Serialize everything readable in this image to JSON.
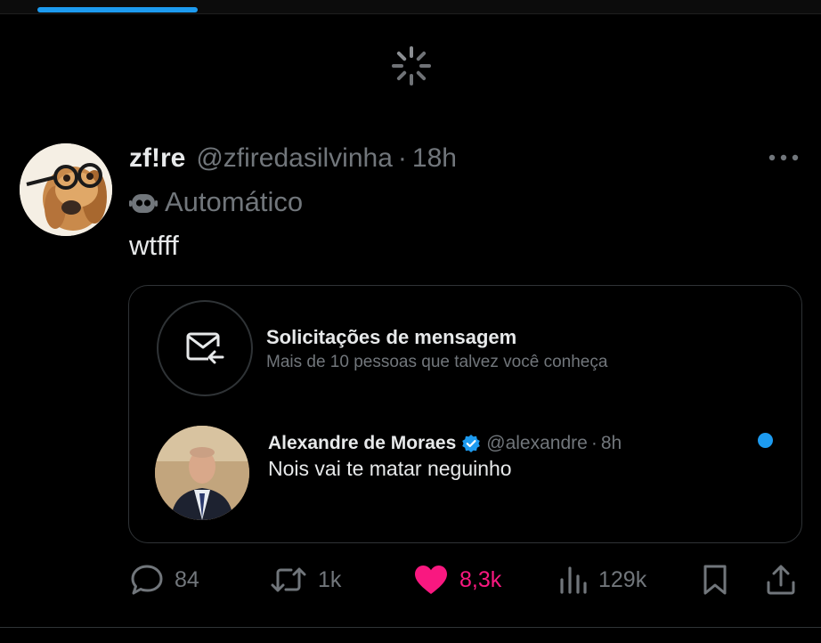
{
  "post": {
    "display_name": "zf!re",
    "handle": "@zfiredasilvinha",
    "separator": "·",
    "time": "18h",
    "automated_label": "Automático",
    "text": "wtfff",
    "avatar_icon": "dog-with-glasses-avatar",
    "more_icon": "more-dots-icon"
  },
  "embedded_card": {
    "requests_title": "Solicitações de mensagem",
    "requests_subtitle": "Mais de 10 pessoas que talvez você conheça",
    "requests_icon": "envelope-arrow-icon",
    "message": {
      "sender_name": "Alexandre de Moraes",
      "sender_handle": "@alexandre",
      "separator": "·",
      "time": "8h",
      "text": "Nois vai te matar neguinho",
      "verified_icon": "verified-badge-icon",
      "unread": true
    }
  },
  "actions": {
    "replies": "84",
    "reposts": "1k",
    "likes": "8,3k",
    "views": "129k"
  },
  "colors": {
    "background": "#000000",
    "accent": "#1d9bf0",
    "like": "#f91880",
    "muted": "#71767b",
    "text": "#e7e9ea",
    "border": "#2f3336"
  }
}
